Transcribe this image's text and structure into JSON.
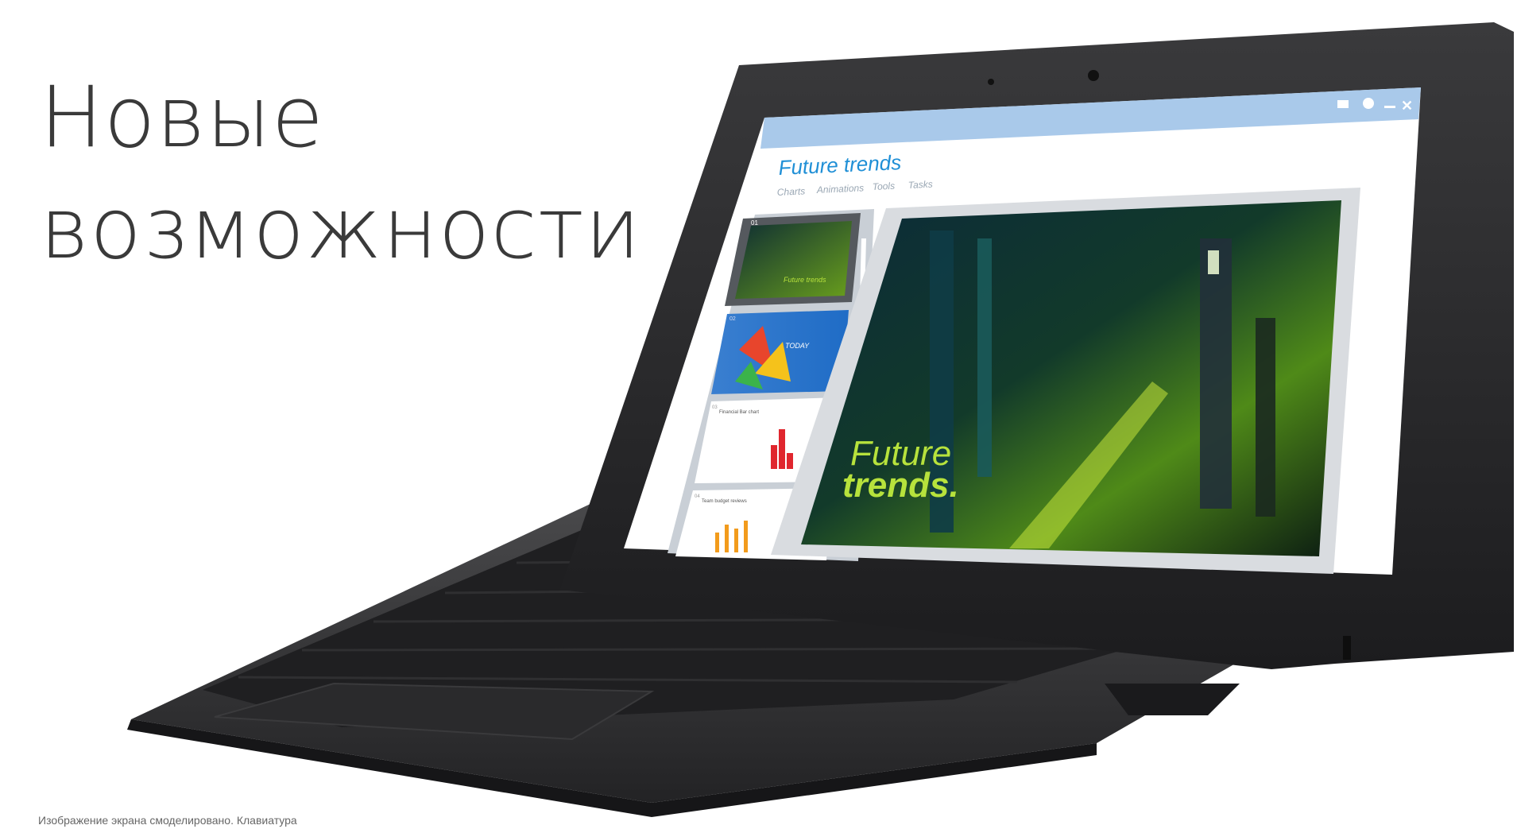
{
  "headline": {
    "line1": "Новые",
    "line2": "возможности"
  },
  "caption": "Изображение экрана смоделировано. Клавиатура",
  "screen_app": {
    "title": "Future trends",
    "tabs": [
      "Charts",
      "Animations",
      "Tools",
      "Tasks"
    ],
    "window_icons": [
      "mail-icon",
      "gear-icon",
      "minimize-icon",
      "close-icon"
    ],
    "slides": [
      {
        "number": "01",
        "caption": "Future trends"
      },
      {
        "number": "02",
        "caption": "TODAY"
      },
      {
        "number": "03",
        "caption": "Financial Bar chart"
      },
      {
        "number": "04",
        "caption": "Team budget reviews"
      }
    ],
    "main_slide_text": {
      "line1": "Future",
      "line2": "trends."
    }
  },
  "colors": {
    "accent": "#1f8fd6",
    "titlebar": "#a9c9ea",
    "device_body": "#2b2b2d",
    "headline_text": "#3a3a3a"
  }
}
